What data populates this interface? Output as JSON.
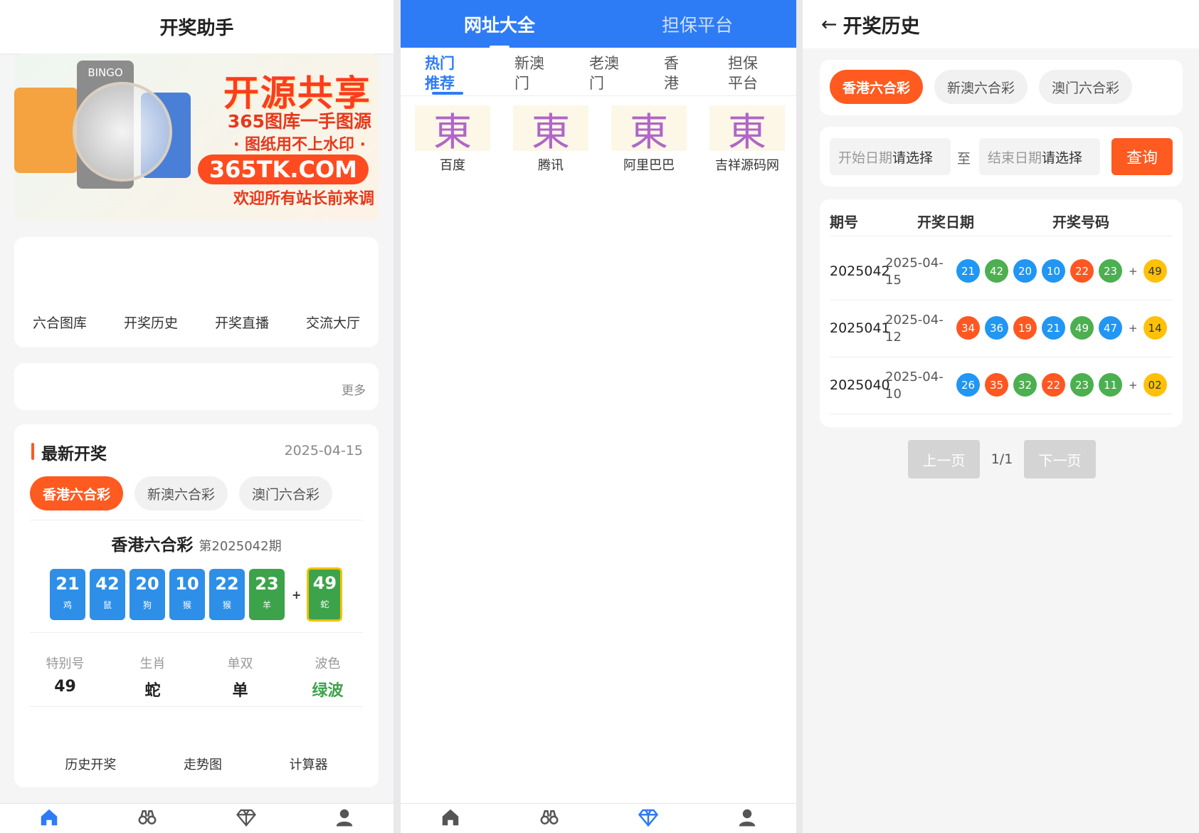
{
  "left": {
    "title": "开奖助手",
    "banner": {
      "headline": "开源共享",
      "line1": "365图库一手图源",
      "line2": "· 图纸用不上水印 ·",
      "url": "365TK.COM",
      "line3": "欢迎所有站长前来调",
      "bingo_label": "BINGO"
    },
    "quick_links": [
      "六合图库",
      "开奖历史",
      "开奖直播",
      "交流大厅"
    ],
    "notice_more": "更多",
    "latest": {
      "title": "最新开奖",
      "date": "2025-04-15",
      "tabs": [
        "香港六合彩",
        "新澳六合彩",
        "澳门六合彩"
      ],
      "lottery_name": "香港六合彩",
      "period": "第2025042期",
      "numbers": [
        {
          "num": "21",
          "zodiac": "鸡",
          "color": "blue"
        },
        {
          "num": "42",
          "zodiac": "鼠",
          "color": "blue"
        },
        {
          "num": "20",
          "zodiac": "狗",
          "color": "blue"
        },
        {
          "num": "10",
          "zodiac": "猴",
          "color": "blue"
        },
        {
          "num": "22",
          "zodiac": "猴",
          "color": "blue"
        },
        {
          "num": "23",
          "zodiac": "羊",
          "color": "green"
        }
      ],
      "plus": "+",
      "special": {
        "num": "49",
        "zodiac": "蛇",
        "color": "green"
      },
      "stats": [
        {
          "label": "特别号",
          "value": "49"
        },
        {
          "label": "生肖",
          "value": "蛇"
        },
        {
          "label": "单双",
          "value": "单"
        },
        {
          "label": "波色",
          "value": "绿波"
        }
      ],
      "links": [
        "历史开奖",
        "走势图",
        "计算器"
      ]
    },
    "nav": [
      "home-icon",
      "binoculars-icon",
      "diamond-icon",
      "user-icon"
    ]
  },
  "middle": {
    "header_tabs": [
      "网址大全",
      "担保平台"
    ],
    "categories": [
      {
        "line1": "热门",
        "line2": "推荐"
      },
      {
        "line1": "新澳",
        "line2": "门"
      },
      {
        "line1": "老澳",
        "line2": "门"
      },
      {
        "line1": "香",
        "line2": "港"
      },
      {
        "line1": "担保",
        "line2": "平台"
      }
    ],
    "sites": [
      {
        "logo": "東",
        "label": "百度"
      },
      {
        "logo": "東",
        "label": "腾讯"
      },
      {
        "logo": "東",
        "label": "阿里巴巴"
      },
      {
        "logo": "東",
        "label": "吉祥源码网"
      }
    ]
  },
  "right": {
    "title": "开奖历史",
    "back_icon": "←",
    "tabs": [
      "香港六合彩",
      "新澳六合彩",
      "澳门六合彩"
    ],
    "start_placeholder": {
      "prefix": "开始日期",
      "action": "请选择"
    },
    "to": "至",
    "end_placeholder": {
      "prefix": "结束日期",
      "action": "请选择"
    },
    "query": "查询",
    "columns": [
      "期号",
      "开奖日期",
      "开奖号码"
    ],
    "rows": [
      {
        "period": "2025042",
        "date1": "2025-04-",
        "date2": "15",
        "balls": [
          {
            "n": "21",
            "c": "blue"
          },
          {
            "n": "42",
            "c": "green"
          },
          {
            "n": "20",
            "c": "blue"
          },
          {
            "n": "10",
            "c": "blue"
          },
          {
            "n": "22",
            "c": "red"
          },
          {
            "n": "23",
            "c": "green"
          }
        ],
        "special": {
          "n": "49",
          "c": "yellow"
        }
      },
      {
        "period": "2025041",
        "date1": "2025-04-",
        "date2": "12",
        "balls": [
          {
            "n": "34",
            "c": "red"
          },
          {
            "n": "36",
            "c": "blue"
          },
          {
            "n": "19",
            "c": "red"
          },
          {
            "n": "21",
            "c": "blue"
          },
          {
            "n": "49",
            "c": "green"
          },
          {
            "n": "47",
            "c": "blue"
          }
        ],
        "special": {
          "n": "14",
          "c": "yellow"
        }
      },
      {
        "period": "2025040",
        "date1": "2025-04-",
        "date2": "10",
        "balls": [
          {
            "n": "26",
            "c": "blue"
          },
          {
            "n": "35",
            "c": "red"
          },
          {
            "n": "32",
            "c": "green"
          },
          {
            "n": "22",
            "c": "red"
          },
          {
            "n": "23",
            "c": "green"
          },
          {
            "n": "11",
            "c": "green"
          }
        ],
        "special": {
          "n": "02",
          "c": "yellow"
        }
      }
    ],
    "plus": "+",
    "prev": "上一页",
    "page": "1/1",
    "next": "下一页"
  },
  "colors": {
    "accent": "#ff5a1f",
    "primary_blue": "#2e7bf6",
    "ball_red": "#ff5722",
    "ball_blue": "#2196f3",
    "ball_green": "#4caf50",
    "ball_yellow": "#ffc107"
  }
}
